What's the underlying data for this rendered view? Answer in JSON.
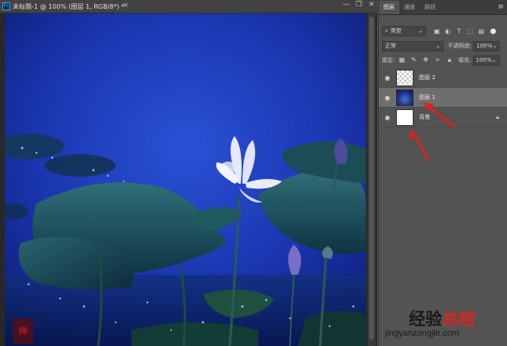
{
  "document": {
    "title": "未标题-1 @ 100% (图层 1, RGB/8*) *",
    "close_glyph": "×",
    "app_icon": "Ps"
  },
  "window_controls": [
    "—",
    "❐",
    "✕"
  ],
  "panel": {
    "tabs": [
      "图层",
      "通道",
      "路径"
    ],
    "menu_glyph": "≡",
    "filter": {
      "label": "类型",
      "icons": [
        "image-filter-icon",
        "adjustment-filter-icon",
        "type-filter-icon",
        "shape-filter-icon",
        "smart-object-filter-icon"
      ]
    },
    "blend_mode": "正常",
    "opacity_label": "不透明度:",
    "opacity_value": "100%",
    "lock_label": "锁定:",
    "fill_label": "填充:",
    "fill_value": "100%",
    "layers": [
      {
        "name": "图层 2",
        "thumb": "transparent",
        "selected": false,
        "locked": false
      },
      {
        "name": "图层 1",
        "thumb": "photo",
        "selected": true,
        "locked": false
      },
      {
        "name": "背景",
        "thumb": "white",
        "selected": false,
        "locked": true
      }
    ]
  },
  "watermark": {
    "text_black": "经验",
    "text_red": "总结",
    "url": "jingyanzongjie.com"
  },
  "colors": {
    "panel_bg": "#535353",
    "selected_layer": "#6e6e6e",
    "arrow_red": "#d9231d",
    "canvas_blue": "#1c3fb8"
  }
}
